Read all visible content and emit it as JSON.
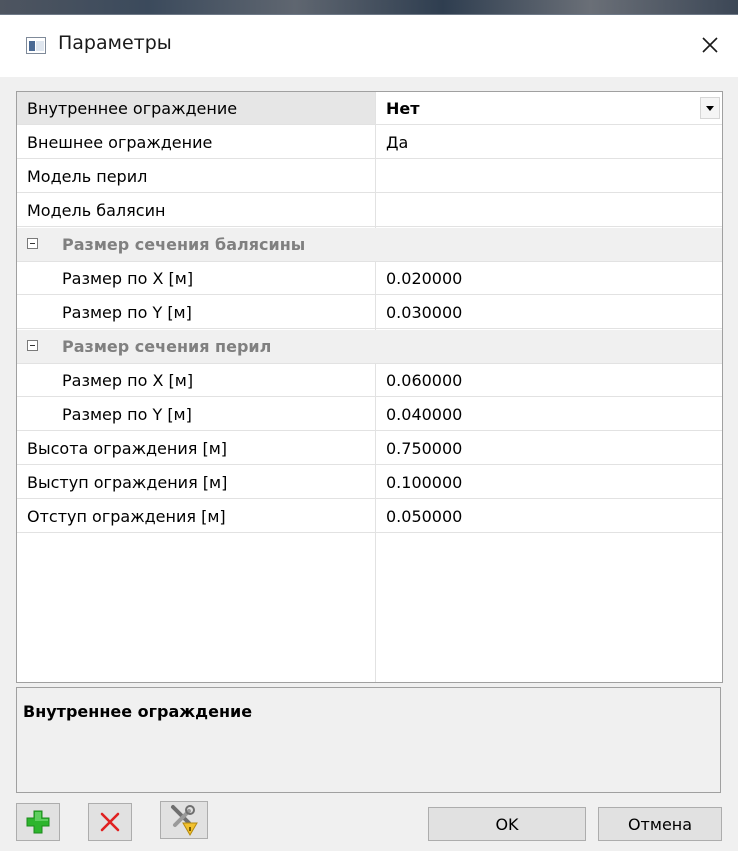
{
  "window": {
    "title": "Параметры",
    "close_icon": "close-icon",
    "app_icon": "dialog-window-icon"
  },
  "properties": {
    "rows": [
      {
        "name": "Внутреннее ограждение",
        "value": "Нет",
        "control": "dropdown"
      },
      {
        "name": "Внешнее ограждение",
        "value": "Да"
      },
      {
        "name": "Модель перил",
        "value": ""
      },
      {
        "name": "Модель балясин",
        "value": ""
      }
    ],
    "group_balusters": {
      "label": "Размер сечения балясины",
      "rows": [
        {
          "name": "Размер по X [м]",
          "value": "0.020000"
        },
        {
          "name": "Размер по Y [м]",
          "value": "0.030000"
        }
      ]
    },
    "group_railing": {
      "label": "Размер сечения перил",
      "rows": [
        {
          "name": "Размер по X [м]",
          "value": "0.060000"
        },
        {
          "name": "Размер по Y [м]",
          "value": "0.040000"
        }
      ]
    },
    "tail_rows": [
      {
        "name": "Высота ограждения [м]",
        "value": "0.750000"
      },
      {
        "name": "Выступ ограждения [м]",
        "value": "0.100000"
      },
      {
        "name": "Отступ ограждения [м]",
        "value": "0.050000"
      }
    ]
  },
  "description": {
    "title": "Внутреннее ограждение"
  },
  "buttons": {
    "ok": "OK",
    "cancel": "Отмена",
    "add_icon": "plus-icon",
    "delete_icon": "x-delete-icon",
    "tools_icon": "tools-icon"
  },
  "colors": {
    "add_green": "#2db52d",
    "delete_red": "#e02020",
    "category_text": "#808080"
  }
}
